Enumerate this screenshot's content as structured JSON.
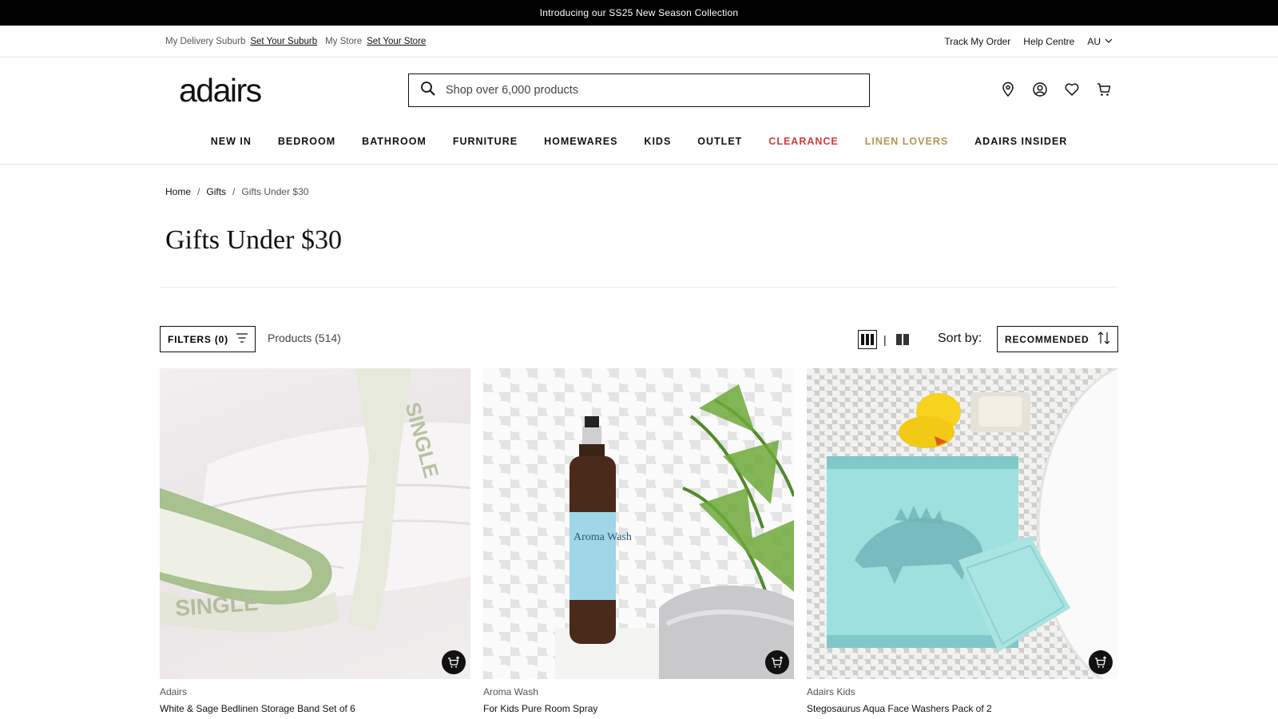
{
  "promo": {
    "text": "Introducing our SS25 New Season Collection"
  },
  "utility": {
    "delivery_label": "My Delivery Suburb",
    "delivery_link": "Set Your Suburb",
    "store_label": "My Store",
    "store_link": "Set Your Store",
    "track_order": "Track My Order",
    "help_centre": "Help Centre",
    "country": "AU"
  },
  "header": {
    "logo": "adairs",
    "search_placeholder": "Shop over 6,000 products",
    "icons": [
      "location-pin-icon",
      "account-icon",
      "wishlist-heart-icon",
      "cart-icon"
    ]
  },
  "nav": {
    "items": [
      {
        "label": "NEW IN"
      },
      {
        "label": "BEDROOM"
      },
      {
        "label": "BATHROOM"
      },
      {
        "label": "FURNITURE"
      },
      {
        "label": "HOMEWARES"
      },
      {
        "label": "KIDS"
      },
      {
        "label": "OUTLET"
      },
      {
        "label": "CLEARANCE",
        "color": "#d63a3a"
      },
      {
        "label": "LINEN LOVERS",
        "color": "#b59551"
      },
      {
        "label": "ADAIRS INSIDER"
      }
    ]
  },
  "breadcrumb": {
    "home": "Home",
    "gifts": "Gifts",
    "current": "Gifts Under $30",
    "separator": "/"
  },
  "page": {
    "title": "Gifts Under $30"
  },
  "toolbar": {
    "filters_label": "FILTERS (0)",
    "product_count": "Products (514)",
    "view_separator": "|",
    "sort_label": "Sort by:",
    "sort_value": "RECOMMENDED"
  },
  "products": [
    {
      "brand": "Adairs",
      "name": "White & Sage Bedlinen Storage Band Set of 6"
    },
    {
      "brand": "Aroma Wash",
      "name": "For Kids Pure Room Spray"
    },
    {
      "brand": "Adairs Kids",
      "name": "Stegosaurus Aqua Face Washers Pack of 2"
    }
  ],
  "image_text": {
    "band_word": "SINGLE",
    "bottle_label": "Aroma Wash"
  }
}
